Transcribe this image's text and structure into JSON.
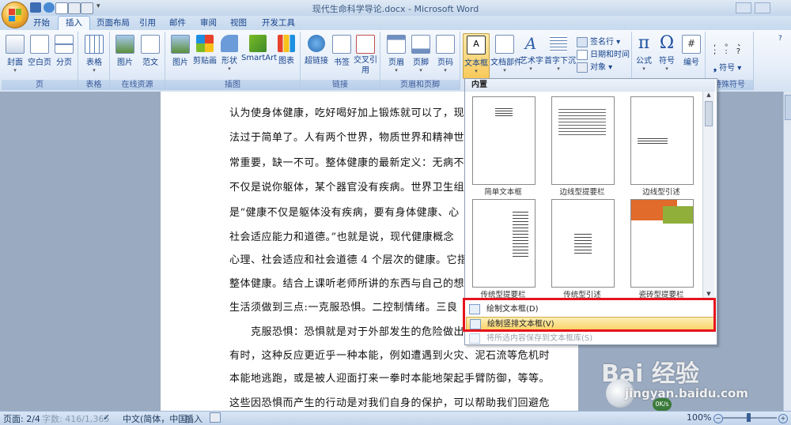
{
  "window": {
    "title": "现代生命科学导论.docx - Microsoft Word"
  },
  "tabs": [
    "开始",
    "插入",
    "页面布局",
    "引用",
    "邮件",
    "审阅",
    "视图",
    "开发工具"
  ],
  "active_tab": "插入",
  "ribbon": {
    "pages": {
      "cover": "封面",
      "blank": "空白页",
      "break": "分页",
      "group": "页"
    },
    "tables": {
      "table": "表格",
      "group": "表格"
    },
    "online": {
      "picture": "图片",
      "sample": "范文",
      "group": "在线资源"
    },
    "illustrations": {
      "picture": "图片",
      "clipart": "剪贴画",
      "shapes": "形状",
      "smartart": "SmartArt",
      "chart": "图表",
      "group": "插图"
    },
    "links": {
      "hyperlink": "超链接",
      "bookmark": "书签",
      "crossref": "交叉引用",
      "group": "链接"
    },
    "header_footer": {
      "header": "页眉",
      "footer": "页脚",
      "pagenum": "页码",
      "group": "页眉和页脚"
    },
    "text": {
      "textbox": "文本框",
      "quickparts": "文档部件",
      "wordart": "艺术字",
      "dropcap": "首字下沉",
      "signature": "签名行",
      "datetime": "日期和时间",
      "object": "对象"
    },
    "symbols": {
      "equation": "公式",
      "symbol": "符号",
      "number": "编号",
      "group": "特殊符号",
      "symbol_label": "符号"
    },
    "special_glyphs": [
      ",",
      "。",
      "、",
      ";",
      ":",
      "?"
    ]
  },
  "document": {
    "lines": [
      "认为使身体健康，吃好喝好加上锻炼就可以了，现",
      "法过于简单了。人有两个世界，物质世界和精神世",
      "常重要，缺一不可。整体健康的最新定义：无病不",
      "不仅是说你躯体，某个器官没有疾病。世界卫生组",
      "是“健康不仅是躯体没有疾病，要有身体健康、心",
      "社会适应能力和道德。”也就是说，现代健康概念",
      "心理、社会适应和社会道德 4 个层次的健康。它指",
      "整体健康。结合上课听老师所讲的东西与自己的想",
      "生活须做到三点:一克服恐惧。二控制情绪。三良",
      "克服恐惧：恐惧就是对于外部发生的危险做出",
      "有时，这种反应更近乎一种本能，例如遭遇到火灾、泥石流等危机时",
      "本能地逃跑，或是被人迎面打来一拳时本能地架起手臂防御，等等。",
      "这些因恐惧而产生的行动是对我们自身的保护，可以帮助我们回避危"
    ]
  },
  "gallery": {
    "header": "内置",
    "items": [
      "简单文本框",
      "边线型提要栏",
      "边线型引述",
      "传统型提要栏",
      "传统型引述",
      "瓷砖型提要栏"
    ],
    "menu": [
      {
        "label": "绘制文本框(D)",
        "enabled": true
      },
      {
        "label": "绘制竖排文本框(V)",
        "enabled": true,
        "highlighted": true
      },
      {
        "label": "将所选内容保存到文本框库(S)",
        "enabled": false
      }
    ]
  },
  "status": {
    "page": "页面: 2/4",
    "words": "字数: 416/1,365",
    "language": "中文(简体，中国)",
    "mode": "插入",
    "zoom": "100%"
  },
  "watermark": {
    "text": "Bai 经验",
    "url": "jingyan.baidu.com",
    "badge": "0K/s"
  },
  "colors": {
    "ribbon": "#e6eef9",
    "highlight": "#f8c95b",
    "red_box": "#e5141d",
    "tab_text": "#15428b"
  }
}
